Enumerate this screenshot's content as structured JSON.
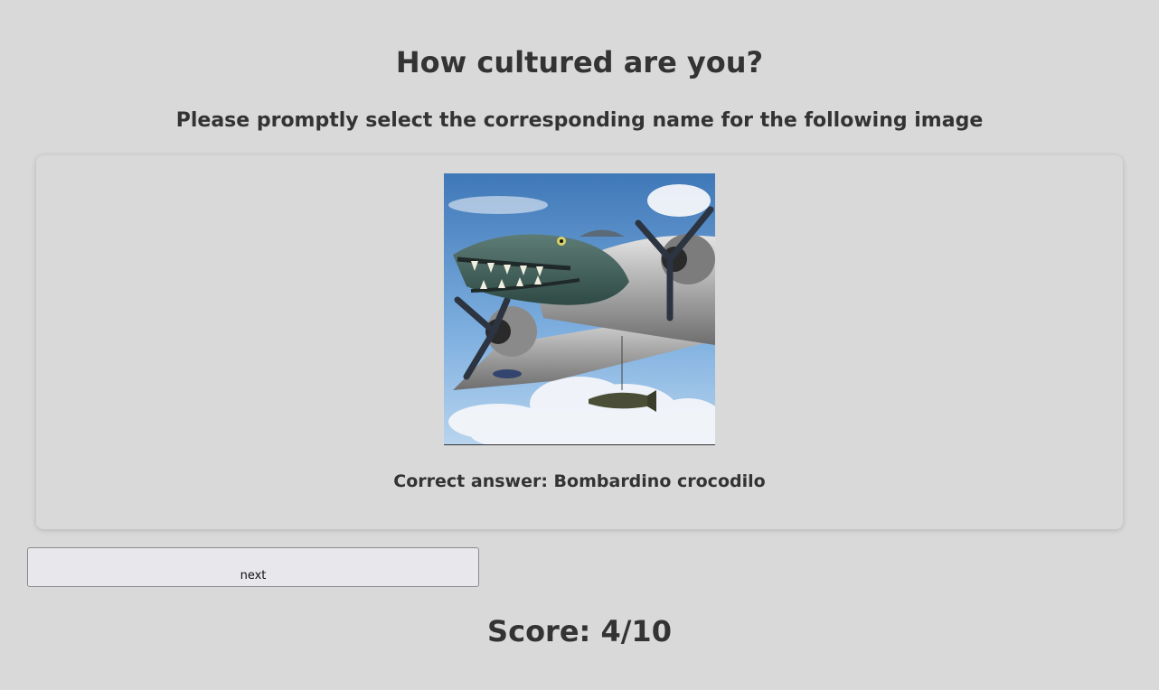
{
  "quiz": {
    "title": "How cultured are you?",
    "prompt": "Please promptly select the corresponding name for the following image",
    "image_subject": "crocodile-headed bomber airplane",
    "answer_text": "Correct answer: Bombardino crocodilo",
    "next_label": "next",
    "score_text": "Score: 4/10"
  },
  "colors": {
    "background": "#d9d9d9",
    "text": "#333333",
    "button_bg": "#e8e7ec",
    "button_border": "#8a8a8e"
  }
}
